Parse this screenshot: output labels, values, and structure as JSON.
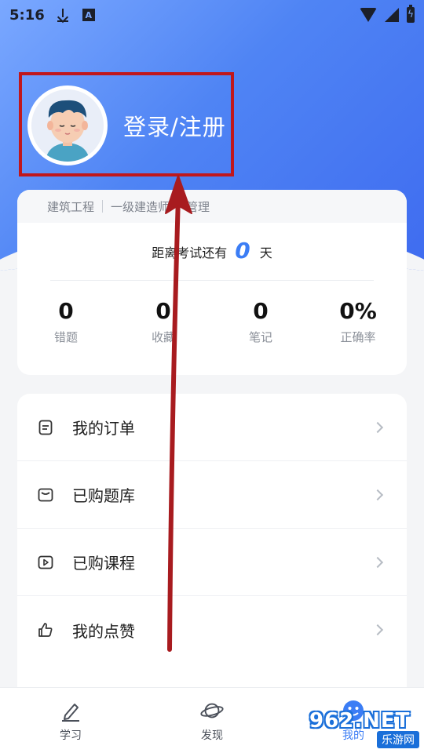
{
  "status_bar": {
    "time": "5:16",
    "a_icon": "A"
  },
  "profile": {
    "login_label": "登录/注册"
  },
  "stats_card": {
    "tags": [
      "建筑工程",
      "一级建造师",
      "管理"
    ],
    "countdown_prefix": "距离考试还有",
    "countdown_days": "0",
    "countdown_suffix": "天",
    "stats": [
      {
        "value": "0",
        "label": "错题"
      },
      {
        "value": "0",
        "label": "收藏"
      },
      {
        "value": "0",
        "label": "笔记"
      },
      {
        "value": "0%",
        "label": "正确率"
      }
    ]
  },
  "menu": {
    "items": [
      {
        "label": "我的订单",
        "icon": "order-icon"
      },
      {
        "label": "已购题库",
        "icon": "question-bank-icon"
      },
      {
        "label": "已购课程",
        "icon": "video-course-icon"
      },
      {
        "label": "我的点赞",
        "icon": "thumbs-up-icon"
      }
    ]
  },
  "bottom_nav": {
    "items": [
      {
        "label": "学习",
        "icon": "pen-icon"
      },
      {
        "label": "发现",
        "icon": "planet-icon"
      },
      {
        "label": "我的",
        "icon": "smile-icon"
      }
    ]
  },
  "watermark": {
    "top": "962.NET",
    "bottom": "乐游网"
  },
  "colors": {
    "accent": "#3b7df5",
    "highlight": "#c0171c",
    "arrow": "#a81b1f"
  }
}
